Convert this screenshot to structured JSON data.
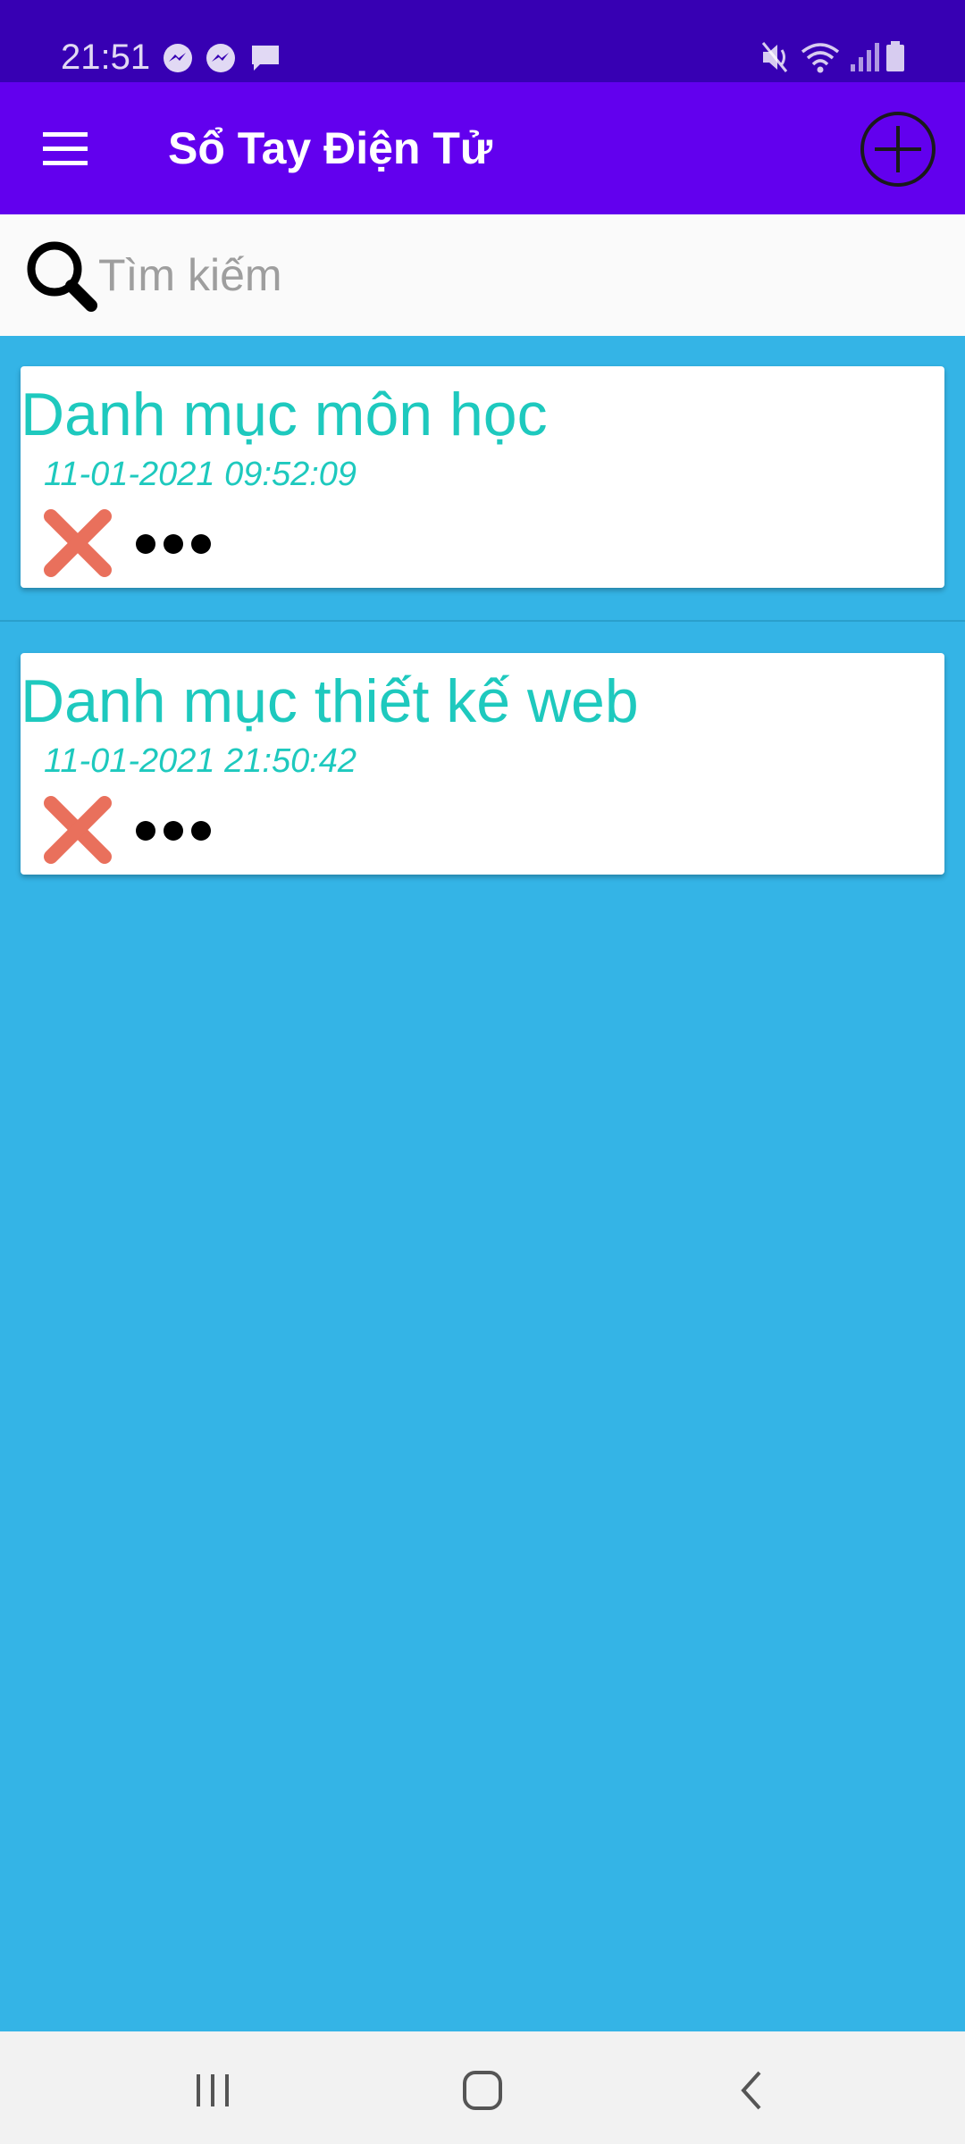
{
  "status_bar": {
    "time": "21:51",
    "left_icons": [
      "messenger-icon",
      "messenger-icon",
      "message-icon"
    ],
    "right_icons": [
      "mute-icon",
      "wifi-icon",
      "signal-icon",
      "battery-icon"
    ]
  },
  "app_bar": {
    "title": "Sổ Tay Điện Tử",
    "menu_icon": "hamburger-menu-icon",
    "add_icon": "plus-circle-icon",
    "color": "#6200EE"
  },
  "search": {
    "placeholder": "Tìm kiếm",
    "value": "",
    "icon": "search-icon"
  },
  "notes": [
    {
      "title": "Danh mục môn học",
      "date": "11-01-2021 09:52:09",
      "delete_icon": "red-x-icon",
      "more_icon": "more-dots-icon"
    },
    {
      "title": "Danh mục thiết kế web",
      "date": "11-01-2021 21:50:42",
      "delete_icon": "red-x-icon",
      "more_icon": "more-dots-icon"
    }
  ],
  "colors": {
    "status_bar": "#3700B3",
    "background": "#34B4E6",
    "accent_text": "#1EC9BE",
    "delete": "#E9705C"
  },
  "nav_bar": {
    "buttons": [
      "recent-apps-icon",
      "home-icon",
      "back-icon"
    ]
  }
}
